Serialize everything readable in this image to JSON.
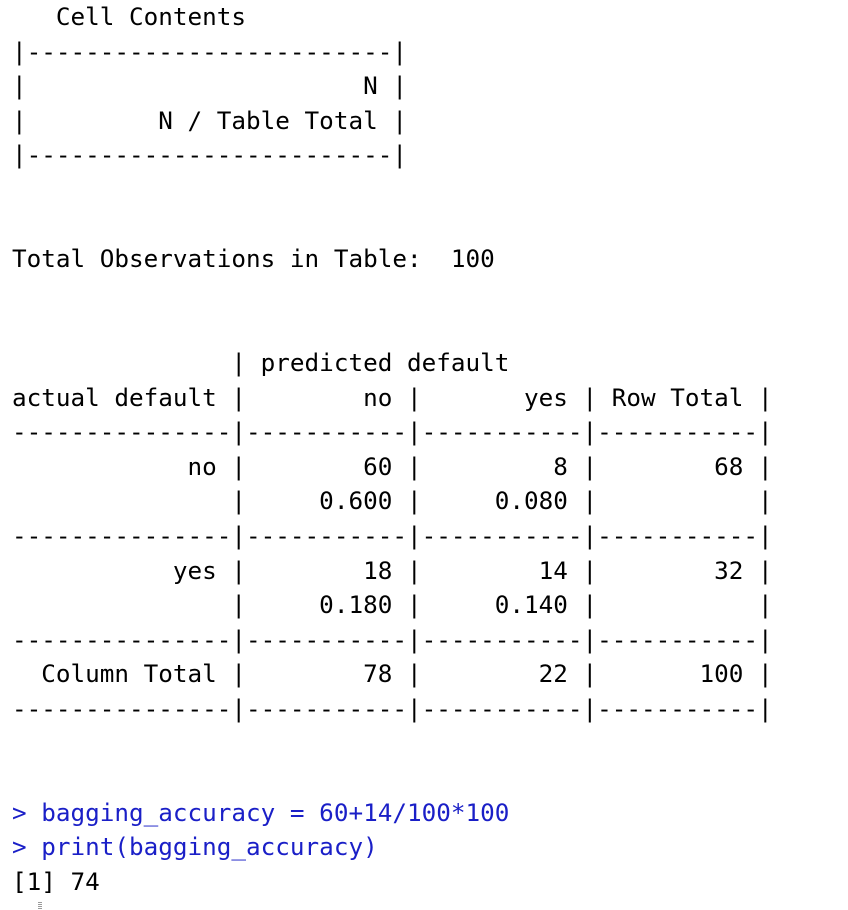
{
  "output": {
    "lines": [
      "   Cell Contents",
      "|-------------------------|",
      "|                       N |",
      "|         N / Table Total |",
      "|-------------------------|",
      "",
      "",
      "Total Observations in Table:  100",
      "",
      "",
      "               | predicted default",
      "actual default |        no |       yes | Row Total |",
      "---------------|-----------|-----------|-----------|",
      "            no |        60 |         8 |        68 |",
      "               |     0.600 |     0.080 |           |",
      "---------------|-----------|-----------|-----------|",
      "           yes |        18 |        14 |        32 |",
      "               |     0.180 |     0.140 |           |",
      "---------------|-----------|-----------|-----------|",
      "  Column Total |        78 |        22 |       100 |",
      "---------------|-----------|-----------|-----------|",
      "",
      ""
    ]
  },
  "commands": [
    "> bagging_accuracy = 60+14/100*100",
    "> print(bagging_accuracy)"
  ],
  "result": "[1] 74",
  "colors": {
    "command_text": "#1a1fc7",
    "output_text": "#000000",
    "background": "#ffffff"
  }
}
